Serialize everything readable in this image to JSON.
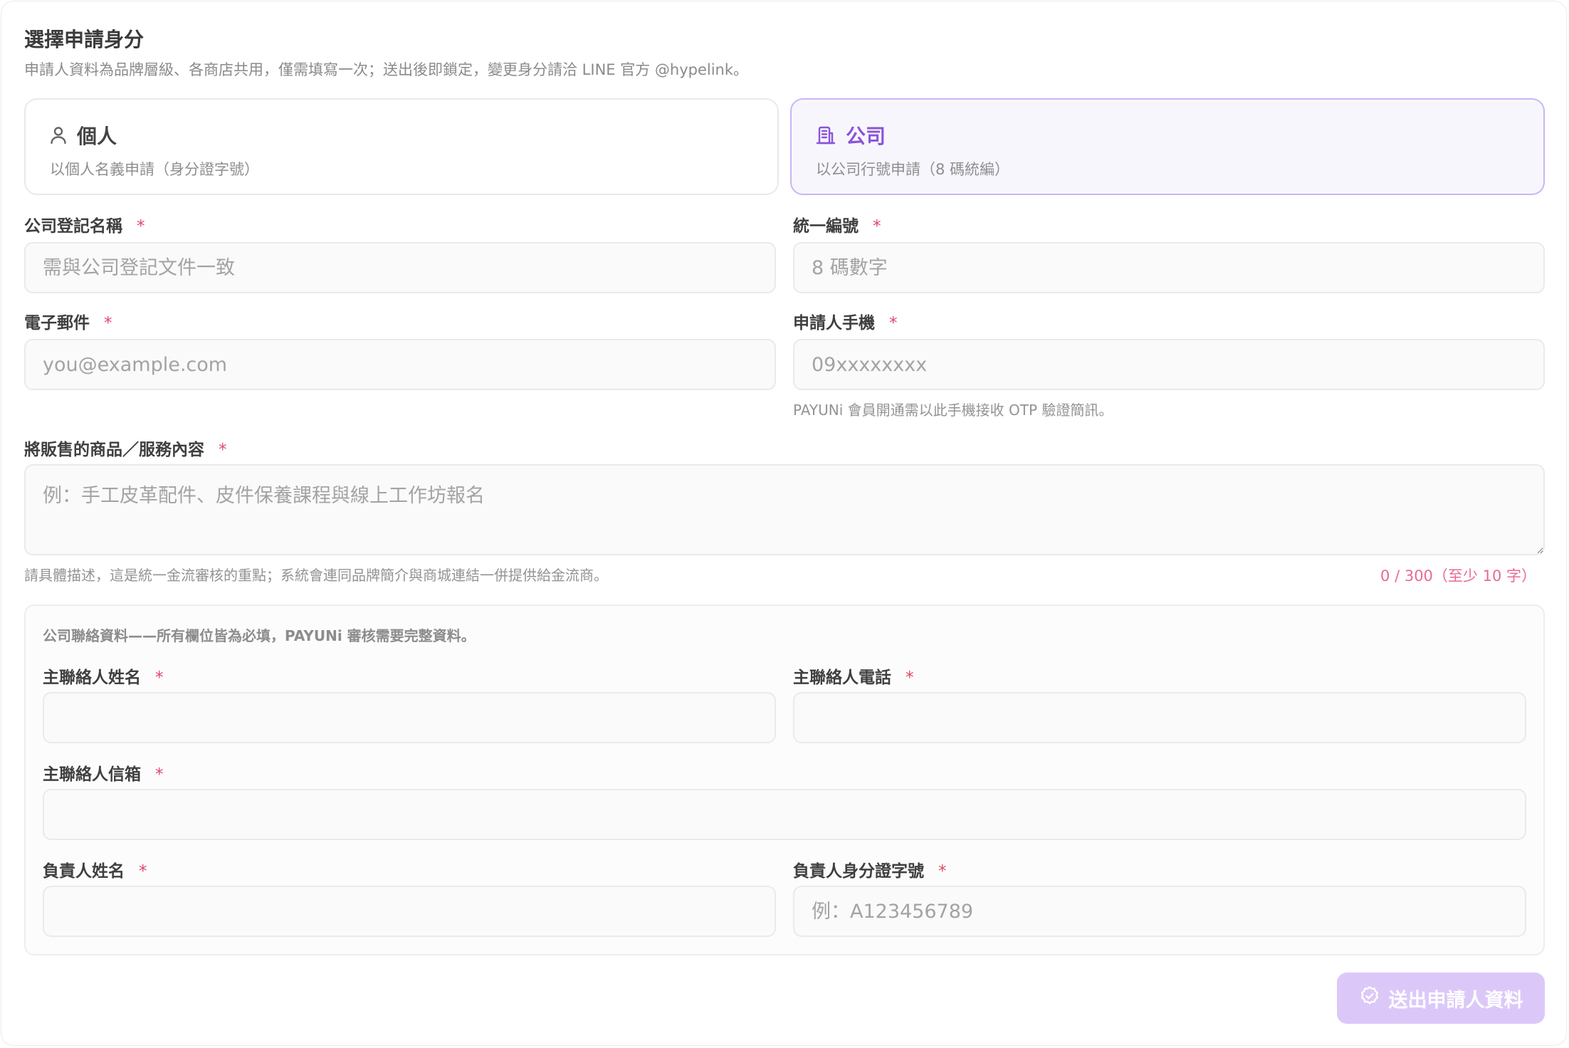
{
  "header": {
    "title": "選擇申請身分",
    "subtitle": "申請人資料為品牌層級、各商店共用，僅需填寫一次；送出後即鎖定，變更身分請洽 LINE 官方 @hypelink。"
  },
  "identity_options": [
    {
      "label": "個人",
      "description": "以個人名義申請（身分證字號）",
      "icon": "person-icon",
      "selected": false
    },
    {
      "label": "公司",
      "description": "以公司行號申請（8 碼統編）",
      "icon": "building-icon",
      "selected": true
    }
  ],
  "required_mark": "*",
  "fields": {
    "company_name": {
      "label": "公司登記名稱",
      "placeholder": "需與公司登記文件一致",
      "value": ""
    },
    "tax_id": {
      "label": "統一編號",
      "placeholder": "8 碼數字",
      "value": ""
    },
    "email": {
      "label": "電子郵件",
      "placeholder": "you@example.com",
      "value": ""
    },
    "phone": {
      "label": "申請人手機",
      "placeholder": "09xxxxxxxx",
      "value": "",
      "hint": "PAYUNi 會員開通需以此手機接收 OTP 驗證簡訊。"
    },
    "products": {
      "label": "將販售的商品／服務內容",
      "placeholder": "例：手工皮革配件、皮件保養課程與線上工作坊報名",
      "value": "",
      "hint": "請具體描述，這是統一金流審核的重點；系統會連同品牌簡介與商城連結一併提供給金流商。",
      "counter": "0 / 300（至少 10 字）"
    }
  },
  "contact": {
    "note": "公司聯絡資料——所有欄位皆為必填，PAYUNi 審核需要完整資料。",
    "contact_name": {
      "label": "主聯絡人姓名",
      "placeholder": "",
      "value": ""
    },
    "contact_phone": {
      "label": "主聯絡人電話",
      "placeholder": "",
      "value": ""
    },
    "contact_email": {
      "label": "主聯絡人信箱",
      "placeholder": "",
      "value": ""
    },
    "owner_name": {
      "label": "負責人姓名",
      "placeholder": "",
      "value": ""
    },
    "owner_id": {
      "label": "負責人身分證字號",
      "placeholder": "例：A123456789",
      "value": ""
    }
  },
  "submit": {
    "label": "送出申請人資料",
    "icon": "check-circle-icon"
  },
  "colors": {
    "accent": "#8a54d8",
    "selected_card_bg": "#f8f6fd",
    "selected_card_border": "#c9b6f3",
    "required": "#e2476a",
    "counter": "#e86a92",
    "submit_bg": "#dcc8f8"
  }
}
